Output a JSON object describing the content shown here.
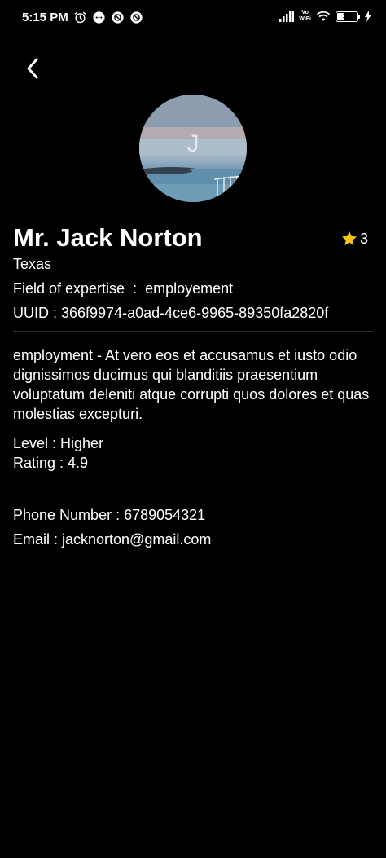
{
  "status_bar": {
    "time": "5:15 PM",
    "vowifi_top": "Vo",
    "vowifi_bottom": "WiFi",
    "battery_level": "34"
  },
  "profile": {
    "avatar_initial": "J",
    "name": "Mr. Jack Norton",
    "star_count": "3",
    "location": "Texas",
    "field_of_expertise": "Field of expertise  :  employement",
    "uuid": "UUID : 366f9974-a0ad-4ce6-9965-89350fa2820f",
    "description": "employment - At vero eos et accusamus et iusto odio dignissimos ducimus qui blanditiis praesentium voluptatum deleniti atque corrupti quos dolores et quas molestias excepturi.",
    "level": "Level : Higher",
    "rating": "Rating : 4.9",
    "phone": "Phone Number : 6789054321",
    "email": "Email : jacknorton@gmail.com"
  },
  "colors": {
    "background": "#000000",
    "text": "#ffffff",
    "star": "#f5c518",
    "divider": "#2e2e2e"
  }
}
